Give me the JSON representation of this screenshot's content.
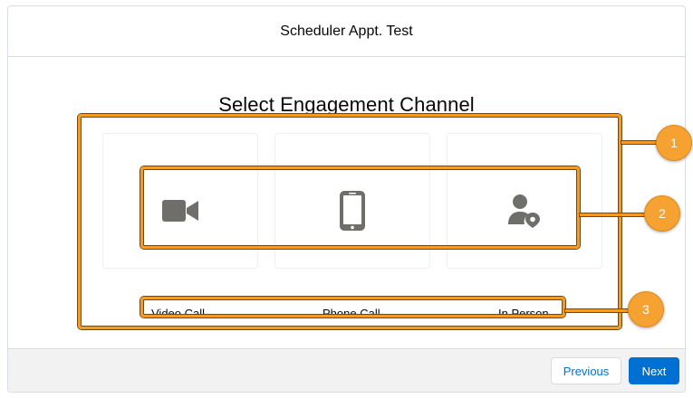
{
  "modal": {
    "title": "Scheduler Appt. Test"
  },
  "main": {
    "heading": "Select Engagement Channel",
    "channels": [
      {
        "label": "Video Call",
        "icon": "video-camera-icon"
      },
      {
        "label": "Phone Call",
        "icon": "mobile-phone-icon"
      },
      {
        "label": "In Person",
        "icon": "person-location-icon"
      }
    ]
  },
  "callouts": [
    "1",
    "2",
    "3"
  ],
  "footer": {
    "previous_label": "Previous",
    "next_label": "Next"
  },
  "colors": {
    "accent_orange": "#f59a23",
    "primary_blue": "#0070d2",
    "icon_gray": "#706e6b"
  }
}
